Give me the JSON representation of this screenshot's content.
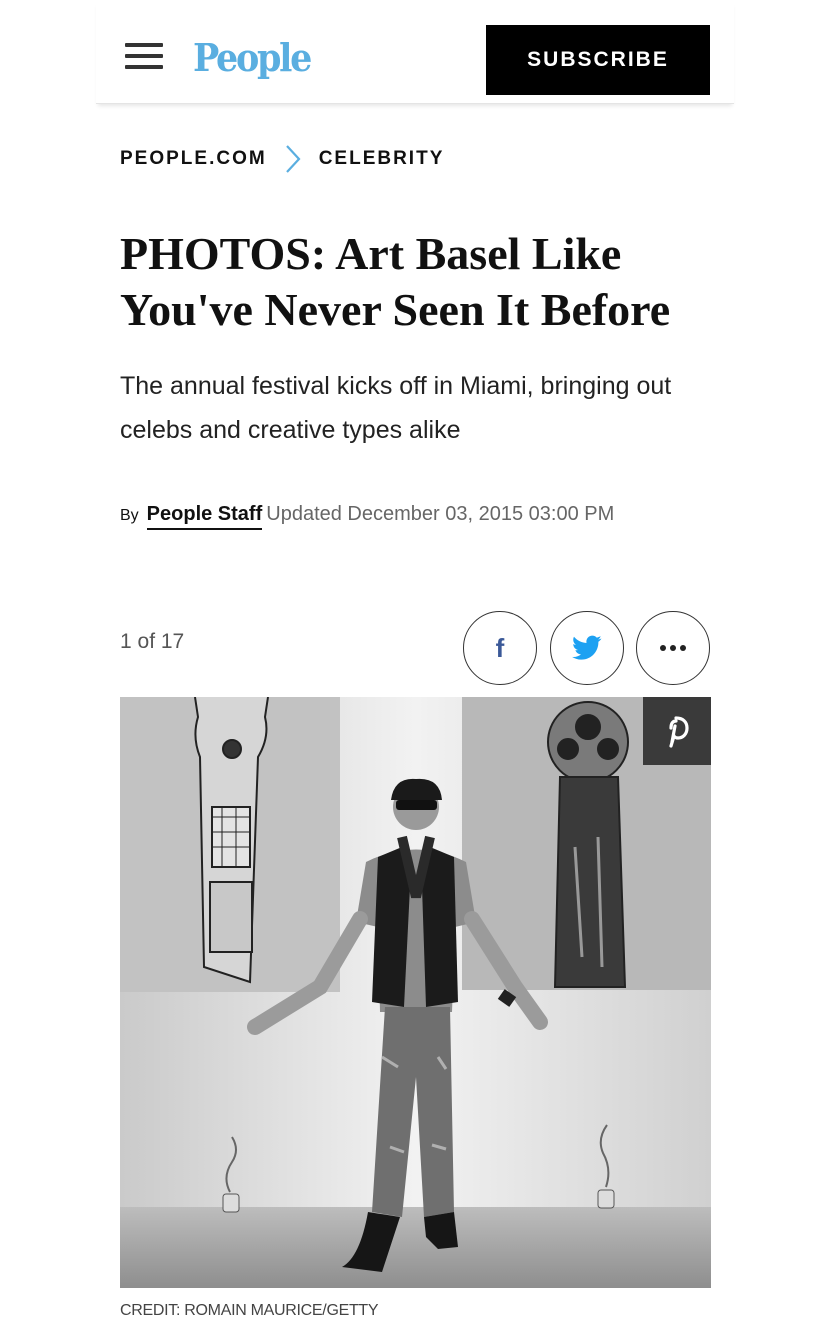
{
  "header": {
    "logo_text": "People",
    "subscribe_label": "SUBSCRIBE",
    "accent_color": "#5aaee0"
  },
  "breadcrumb": {
    "items": [
      {
        "label": "PEOPLE.COM"
      },
      {
        "label": "CELEBRITY"
      }
    ],
    "separator_icon": "chevron-right-icon",
    "separator_color": "#5aaee0"
  },
  "article": {
    "headline": "PHOTOS: Art Basel Like You've Never Seen It Before",
    "dek": "The annual festival kicks off in Miami, bringing out celebs and creative types alike",
    "byline": {
      "by_label": "By",
      "author": "People Staff",
      "updated": "Updated December 03, 2015 03:00 PM"
    }
  },
  "gallery": {
    "counter": "1 of 17",
    "share": {
      "facebook_icon": "facebook-icon",
      "twitter_icon": "twitter-icon",
      "more_icon": "more-dots-icon",
      "facebook_color": "#3b5998",
      "twitter_color": "#1da1f2"
    },
    "photo": {
      "pinterest_icon": "pinterest-icon",
      "style": "black-and-white"
    },
    "credit": "CREDIT: ROMAIN MAURICE/GETTY"
  }
}
